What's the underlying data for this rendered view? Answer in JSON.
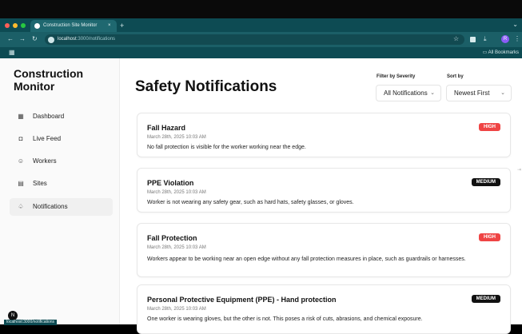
{
  "browser": {
    "tab_title": "Construction Site Monitor",
    "tab_close": "×",
    "new_tab": "+",
    "url_host": "localhost",
    "url_rest": ":3000/notifications",
    "bookmarks_label": "All Bookmarks",
    "avatar_letter": "R",
    "status_url": "localhost:3000/notifications"
  },
  "sidebar": {
    "brand": "Construction Monitor",
    "items": [
      {
        "label": "Dashboard",
        "icon": "dashboard-icon"
      },
      {
        "label": "Live Feed",
        "icon": "video-icon"
      },
      {
        "label": "Workers",
        "icon": "users-icon"
      },
      {
        "label": "Sites",
        "icon": "building-icon"
      },
      {
        "label": "Notifications",
        "icon": "bell-icon"
      }
    ],
    "active": "Notifications",
    "bottom_badge": "N"
  },
  "main": {
    "title": "Safety Notifications",
    "filter_label": "Filter by Severity",
    "filter_value": "All Notifications",
    "sort_label": "Sort by",
    "sort_value": "Newest First"
  },
  "notifications": [
    {
      "title": "Fall Hazard",
      "date": "March 28th, 2025 10:03 AM",
      "message": "No fall protection is visible for the worker working near the edge.",
      "severity": "HIGH"
    },
    {
      "title": "PPE Violation",
      "date": "March 28th, 2025 10:03 AM",
      "message": "Worker is not wearing any safety gear, such as hard hats, safety glasses, or gloves.",
      "severity": "MEDIUM"
    },
    {
      "title": "Fall Protection",
      "date": "March 28th, 2025 10:03 AM",
      "message": "Workers appear to be working near an open edge without any fall protection measures in place, such as guardrails or harnesses.",
      "severity": "HIGH"
    },
    {
      "title": "Personal Protective Equipment (PPE) - Hand protection",
      "date": "March 28th, 2025 10:03 AM",
      "message": "One worker is wearing gloves, but the other is not. This poses a risk of cuts, abrasions, and chemical exposure.",
      "severity": "MEDIUM"
    }
  ],
  "colors": {
    "high": "#ef4444",
    "medium": "#111111",
    "browser_chrome": "#0d4b53"
  }
}
